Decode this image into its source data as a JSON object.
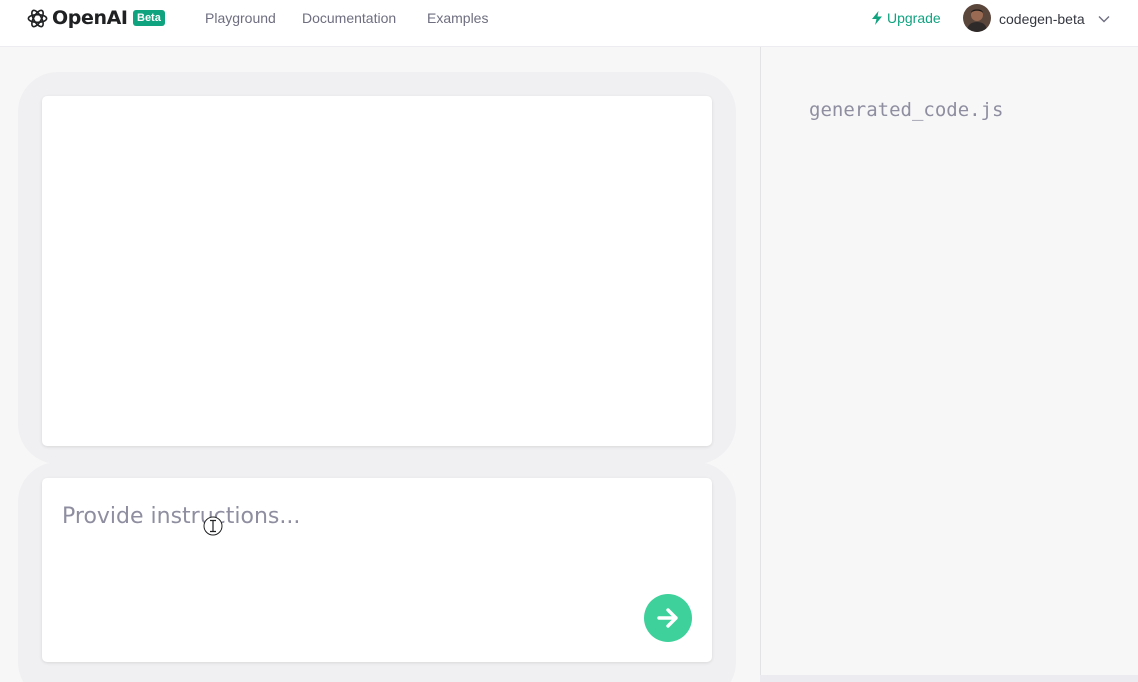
{
  "header": {
    "brand": "OpenAI",
    "badge": "Beta",
    "nav": [
      {
        "label": "Playground"
      },
      {
        "label": "Documentation"
      },
      {
        "label": "Examples"
      }
    ],
    "upgrade_label": "Upgrade",
    "username": "codegen-beta"
  },
  "main": {
    "instructions_placeholder": "Provide instructions...",
    "instructions_value": ""
  },
  "output": {
    "filename": "generated_code.js"
  },
  "colors": {
    "accent": "#10a37f",
    "submit": "#3ed19b",
    "background": "#f7f7f8"
  },
  "icons": [
    "openai-logo-icon",
    "bolt-icon",
    "chevron-down-icon",
    "arrow-right-icon",
    "text-cursor-icon"
  ]
}
